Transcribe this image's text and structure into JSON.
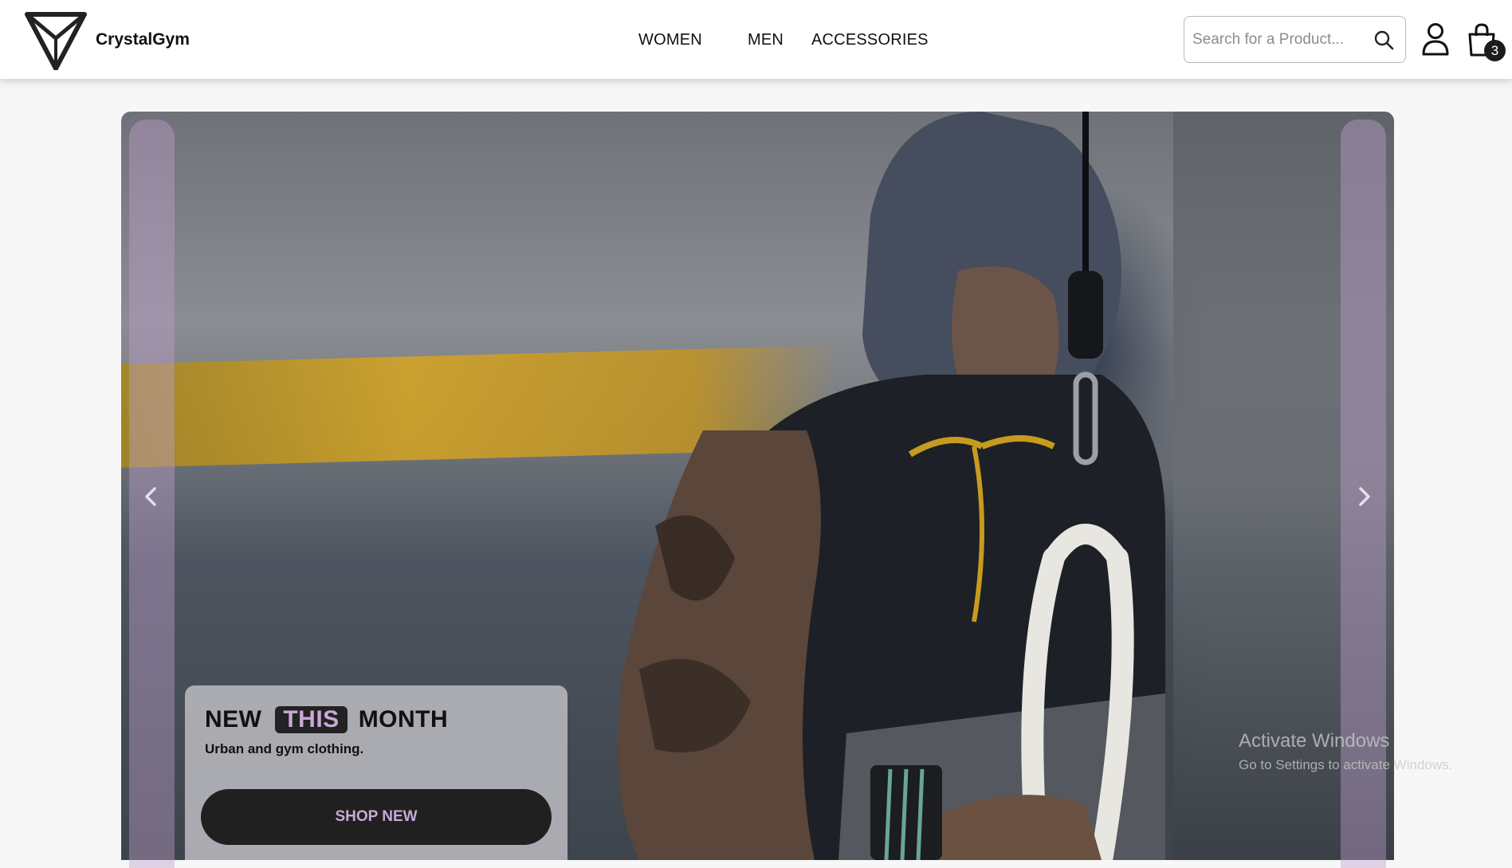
{
  "header": {
    "brand": "CrystalGym",
    "nav": [
      {
        "label": "WOMEN"
      },
      {
        "label": "MEN"
      },
      {
        "label": "ACCESSORIES"
      }
    ],
    "search": {
      "placeholder": "Search for a Product...",
      "value": ""
    },
    "cart_count": "3"
  },
  "hero": {
    "headline_1": "NEW",
    "headline_highlight": "THIS",
    "headline_2": "MONTH",
    "subtitle": "Urban and gym clothing.",
    "cta_label": "SHOP NEW"
  },
  "watermark": {
    "title": "Activate Windows",
    "subtitle": "Go to Settings to activate Windows."
  },
  "colors": {
    "accent": "#c9a8d6",
    "dark": "#202020",
    "panel_tint": "#bea0cd"
  },
  "icons": [
    "logo-icon",
    "search-icon",
    "user-icon",
    "cart-icon",
    "chevron-left-icon",
    "chevron-right-icon"
  ]
}
